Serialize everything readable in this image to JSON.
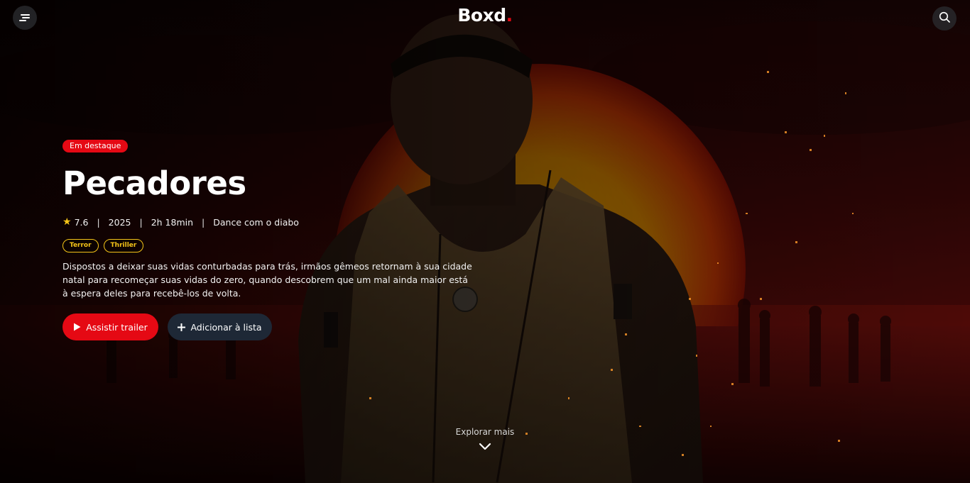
{
  "header": {
    "logo_text": "Boxd",
    "logo_dot": ".",
    "logo_dot_color": "#e50914",
    "menu_icon": "menu-icon",
    "search_icon": "search-icon"
  },
  "featured": {
    "badge": "Em destaque",
    "title": "Pecadores",
    "rating": "7.6",
    "year": "2025",
    "duration": "2h 18min",
    "tagline": "Dance com o diabo",
    "genres": [
      "Terror",
      "Thriller"
    ],
    "synopsis": "Dispostos a deixar suas vidas conturbadas para trás, irmãos gêmeos retornam à sua cidade natal para recomeçar suas vidas do zero, quando descobrem que um mal ainda maior está à espera deles para recebê-los de volta."
  },
  "actions": {
    "trailer_label": "Assistir trailer",
    "add_list_label": "Adicionar à lista"
  },
  "explore": {
    "label": "Explorar mais"
  },
  "colors": {
    "accent": "#e50914",
    "genre": "#f5c518",
    "secondary_button": "#1e2836"
  }
}
